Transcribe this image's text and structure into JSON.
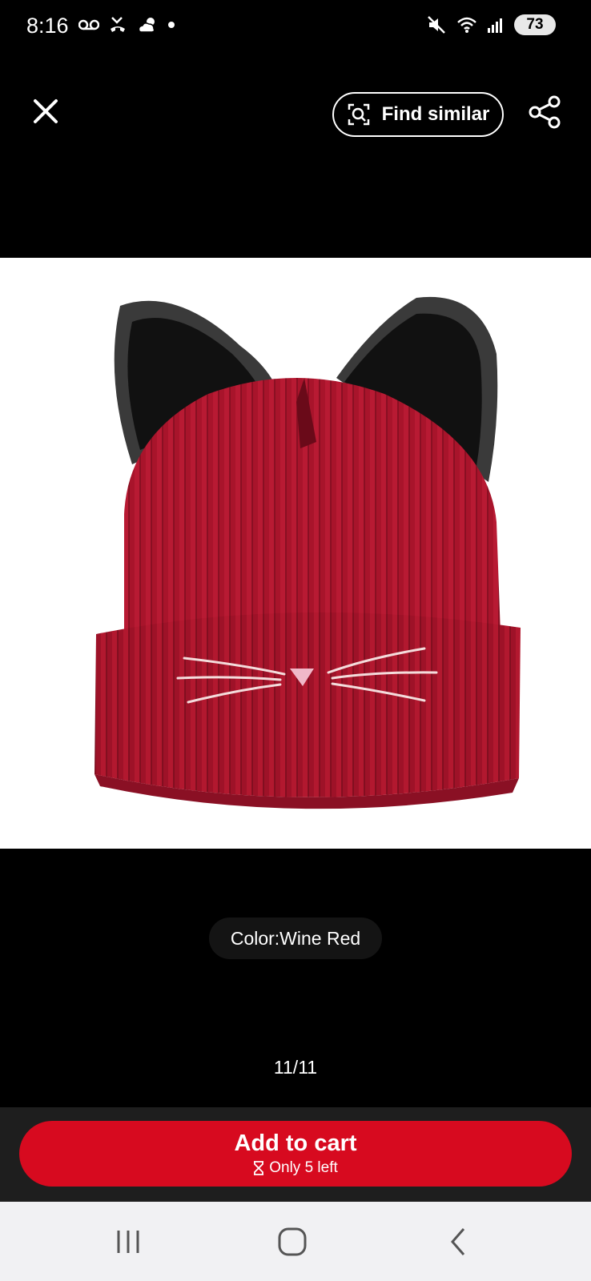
{
  "status_bar": {
    "time": "8:16",
    "battery": "73",
    "icons_left": [
      "voicemail-icon",
      "missed-call-icon",
      "weather-icon",
      "dot-icon"
    ],
    "icons_right": [
      "mute-icon",
      "wifi-icon",
      "signal-icon",
      "battery-icon"
    ]
  },
  "top_bar": {
    "close_icon": "close-icon",
    "find_similar_label": "Find similar",
    "find_similar_icon": "visual-search-icon",
    "share_icon": "share-icon"
  },
  "product": {
    "image_description": "wine red knit beanie with black cat ears",
    "color_label": "Color:Wine Red",
    "page_counter": "11/11"
  },
  "cart": {
    "button_label": "Add to cart",
    "stock_icon": "hourglass-icon",
    "stock_text": "Only 5 left",
    "accent_color": "#d70a1f"
  },
  "system_nav": {
    "buttons": [
      "recent-apps",
      "home",
      "back"
    ]
  }
}
